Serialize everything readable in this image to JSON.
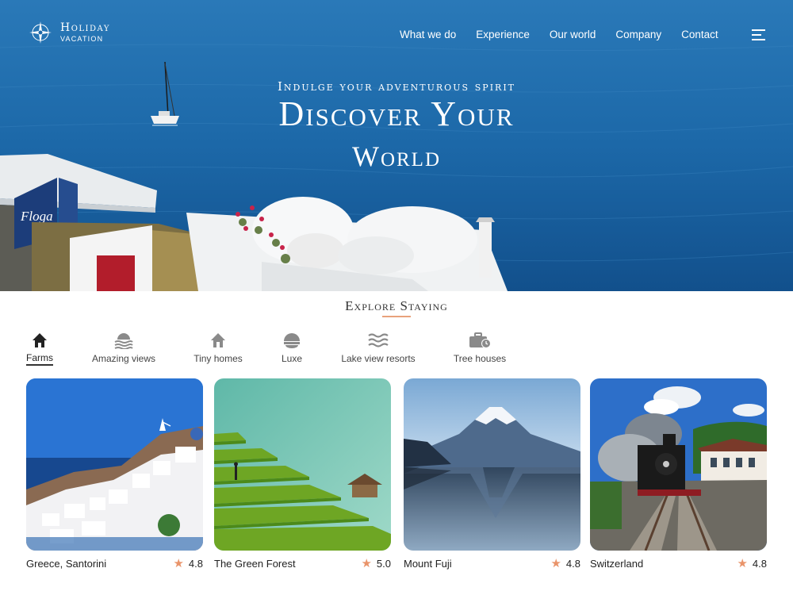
{
  "brand": {
    "line1": "Holiday",
    "line2": "VACATION"
  },
  "nav": {
    "items": [
      "What we do",
      "Experience",
      "Our world",
      "Company",
      "Contact"
    ]
  },
  "hero": {
    "subtitle": "Indulge your adventurous spirit",
    "title_line1": "Discover Your",
    "title_line2": "World"
  },
  "explore": {
    "title": "Explore Staying",
    "categories": [
      {
        "label": "Farms",
        "icon": "home-icon",
        "active": true
      },
      {
        "label": "Amazing views",
        "icon": "sunset-waves-icon",
        "active": false
      },
      {
        "label": "Tiny homes",
        "icon": "small-house-icon",
        "active": false
      },
      {
        "label": "Luxe",
        "icon": "dome-icon",
        "active": false
      },
      {
        "label": "Lake view resorts",
        "icon": "waves-icon",
        "active": false
      },
      {
        "label": "Tree houses",
        "icon": "suitcase-clock-icon",
        "active": false
      }
    ]
  },
  "listings": [
    {
      "name": "Greece, Santorini",
      "rating": "4.8"
    },
    {
      "name": "The Green Forest",
      "rating": "5.0"
    },
    {
      "name": "Mount Fuji",
      "rating": "4.8"
    },
    {
      "name": "Switzerland",
      "rating": "4.8"
    }
  ],
  "colors": {
    "accent": "#e9946a",
    "sea": "#1a66a6"
  },
  "hero_sign": "Floga"
}
